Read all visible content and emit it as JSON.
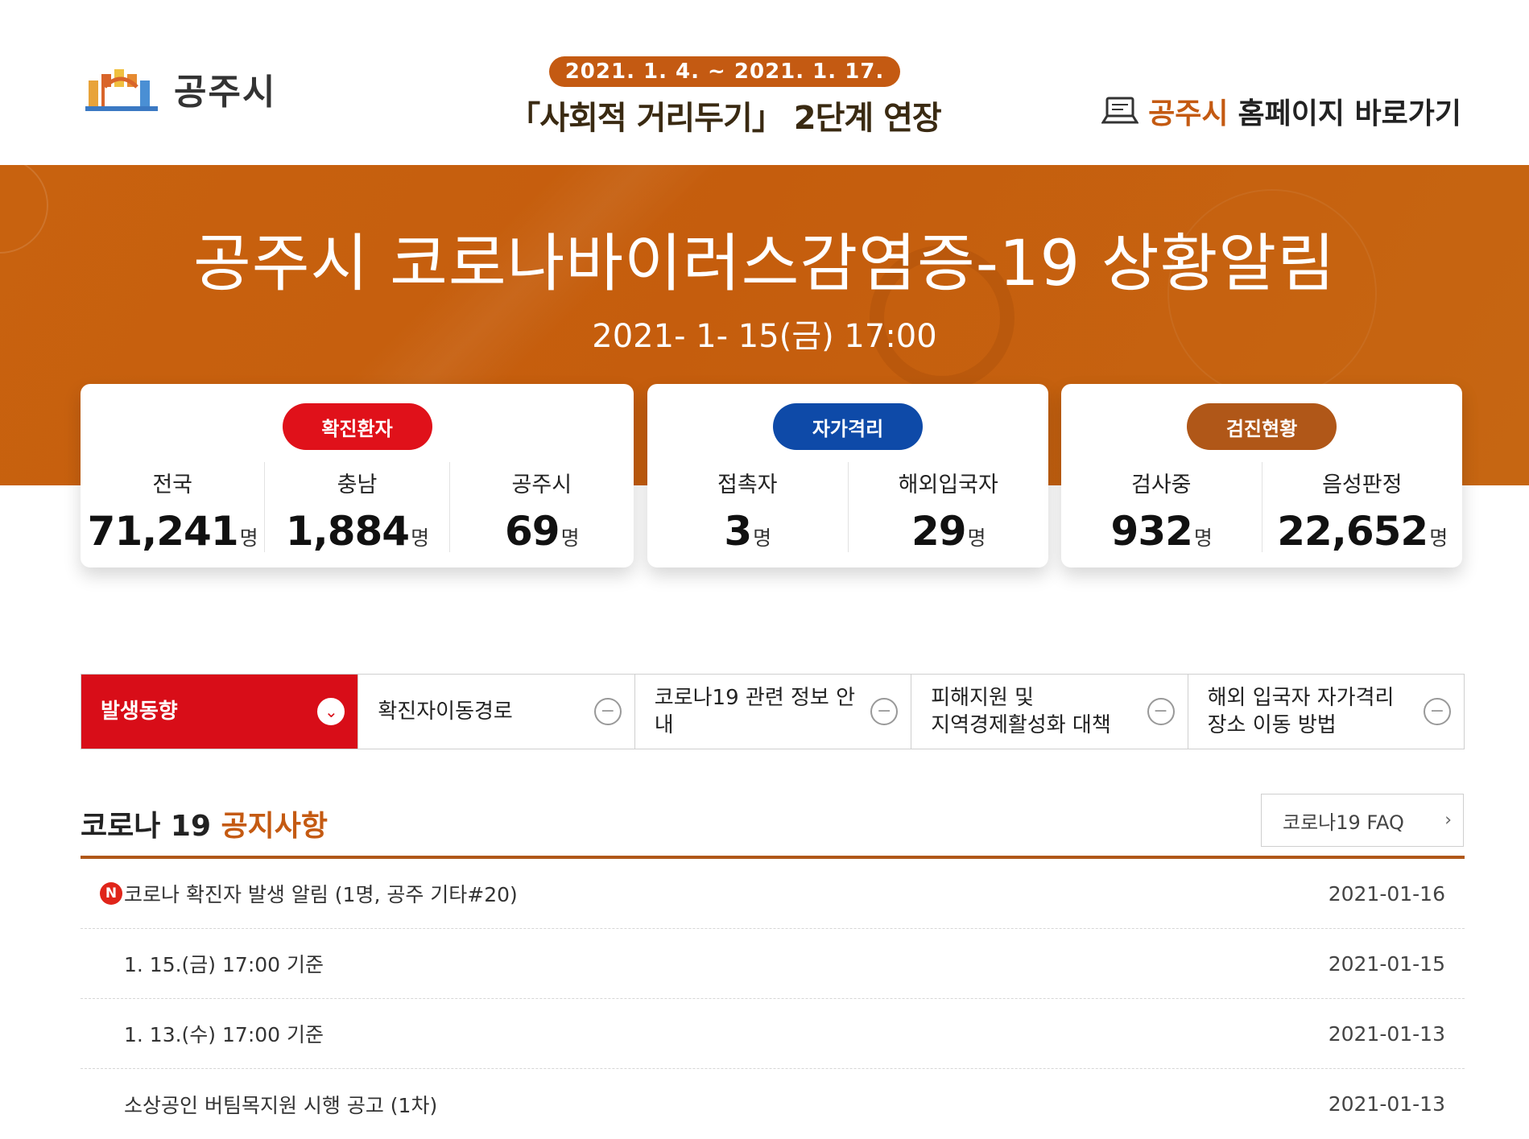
{
  "header": {
    "logo_text": "공주시",
    "campaign_date": "2021. 1. 4. ~ 2021. 1. 17.",
    "campaign_title": "「사회적 거리두기」 2단계 연장",
    "home_link_brand": "공주시",
    "home_link_rest": "홈페이지 바로가기"
  },
  "banner": {
    "title": "공주시 코로나바이러스감염증-19 상황알림",
    "datetime": "2021- 1- 15(금) 17:00"
  },
  "cards": {
    "confirmed": {
      "pill": "확진환자",
      "items": [
        {
          "label": "전국",
          "value": "71,241",
          "unit": "명"
        },
        {
          "label": "충남",
          "value": "1,884",
          "unit": "명"
        },
        {
          "label": "공주시",
          "value": "69",
          "unit": "명"
        }
      ]
    },
    "quarantine": {
      "pill": "자가격리",
      "items": [
        {
          "label": "접촉자",
          "value": "3",
          "unit": "명"
        },
        {
          "label": "해외입국자",
          "value": "29",
          "unit": "명"
        }
      ]
    },
    "testing": {
      "pill": "검진현황",
      "items": [
        {
          "label": "검사중",
          "value": "932",
          "unit": "명"
        },
        {
          "label": "음성판정",
          "value": "22,652",
          "unit": "명"
        }
      ]
    }
  },
  "tabs": [
    {
      "label": "발생동향",
      "icon": "chevron-down"
    },
    {
      "label": "확진자이동경로",
      "icon": "minus"
    },
    {
      "label": "코로나19 관련 정보 안내",
      "icon": "minus"
    },
    {
      "label": "피해지원 및\n지역경제활성화 대책",
      "icon": "minus"
    },
    {
      "label": "해외 입국자 자가격리\n장소 이동 방법",
      "icon": "minus"
    }
  ],
  "notices": {
    "title_prefix": "코로나 19",
    "title_highlight": "공지사항",
    "faq_label": "코로나19 FAQ",
    "faq_chevron": "›",
    "new_badge": "N",
    "items": [
      {
        "text": "코로나 확진자 발생 알림 (1명, 공주 기타#20)",
        "date": "2021-01-16"
      },
      {
        "text": "1. 15.(금) 17:00 기준",
        "date": "2021-01-15"
      },
      {
        "text": "1. 13.(수) 17:00 기준",
        "date": "2021-01-13"
      },
      {
        "text": "소상공인 버팀목지원 시행 공고 (1차)",
        "date": "2021-01-13"
      }
    ]
  },
  "colors": {
    "brand_orange": "#c45a12",
    "banner_orange": "#c8620f",
    "confirmed_red": "#e0111a",
    "quarantine_blue": "#0e4aa8",
    "testing_brown": "#b05718",
    "active_tab_red": "#d80d18"
  }
}
